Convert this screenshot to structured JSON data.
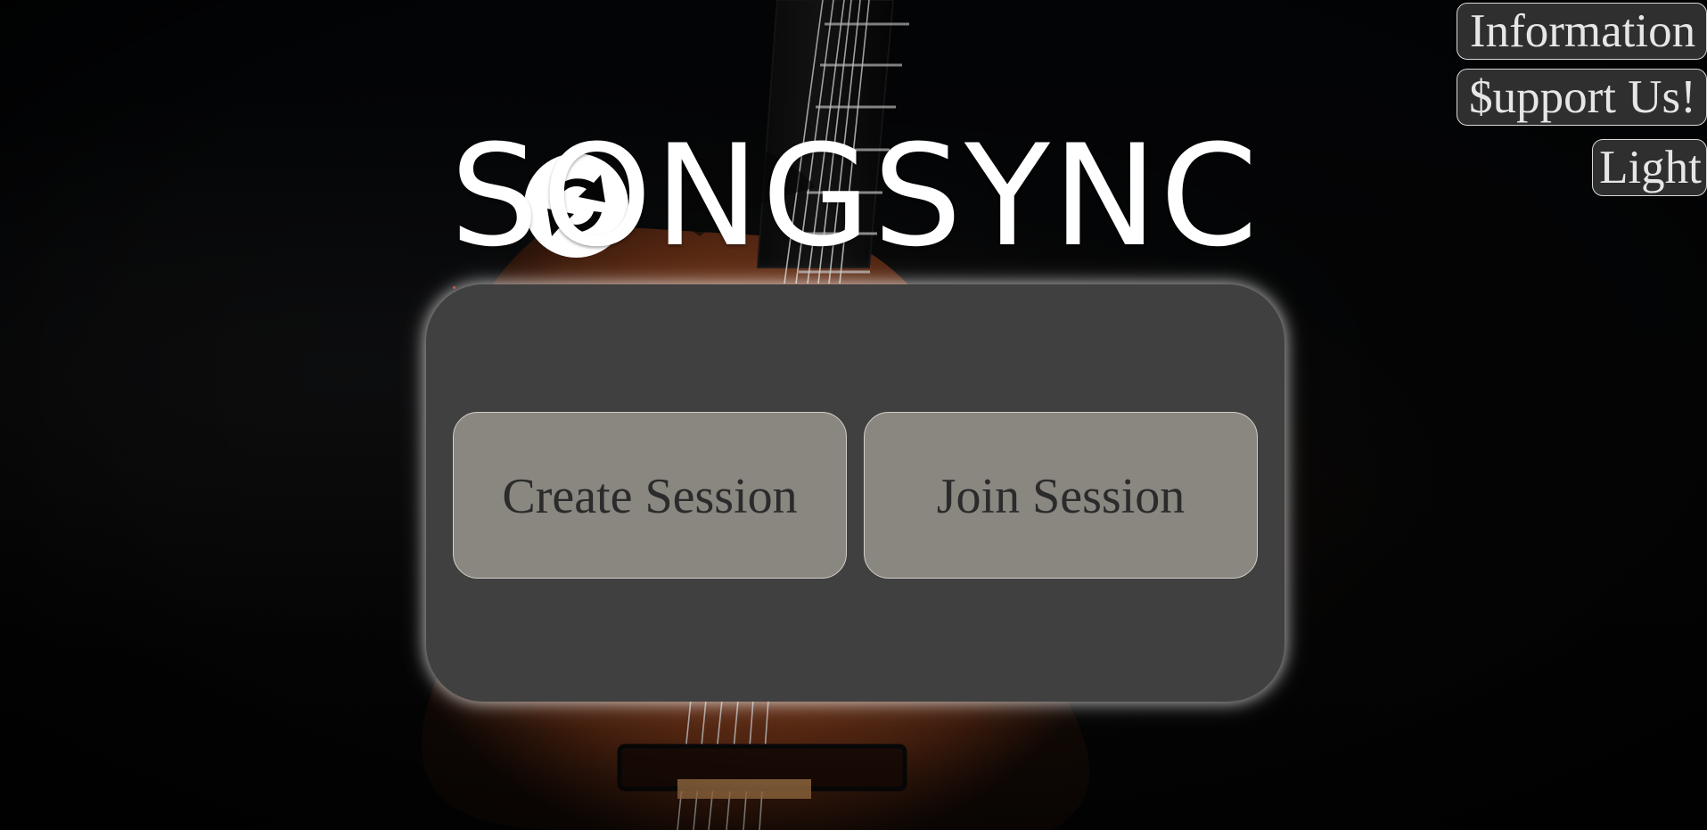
{
  "nav": {
    "information_label": "Information",
    "support_label": "$upport Us!",
    "theme_label": "Light"
  },
  "brand": {
    "logo_text": "SONGSYNC",
    "logo_icon": "sync-icon",
    "accent_color": "#ffffff"
  },
  "actions": {
    "create_label": "Create Session",
    "join_label": "Join Session"
  },
  "background": {
    "subject": "guitar-image",
    "panel_color": "#404040",
    "button_color": "#8a8680"
  }
}
